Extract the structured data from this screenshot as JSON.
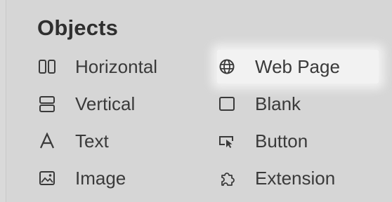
{
  "panel": {
    "title": "Objects",
    "items": [
      {
        "label": "Horizontal",
        "icon": "horizontal-layout-icon"
      },
      {
        "label": "Vertical",
        "icon": "vertical-layout-icon"
      },
      {
        "label": "Text",
        "icon": "text-icon"
      },
      {
        "label": "Image",
        "icon": "image-icon"
      },
      {
        "label": "Web Page",
        "icon": "globe-icon"
      },
      {
        "label": "Blank",
        "icon": "blank-icon"
      },
      {
        "label": "Button",
        "icon": "button-icon"
      },
      {
        "label": "Extension",
        "icon": "extension-icon"
      }
    ],
    "highlighted_item": "Web Page"
  }
}
